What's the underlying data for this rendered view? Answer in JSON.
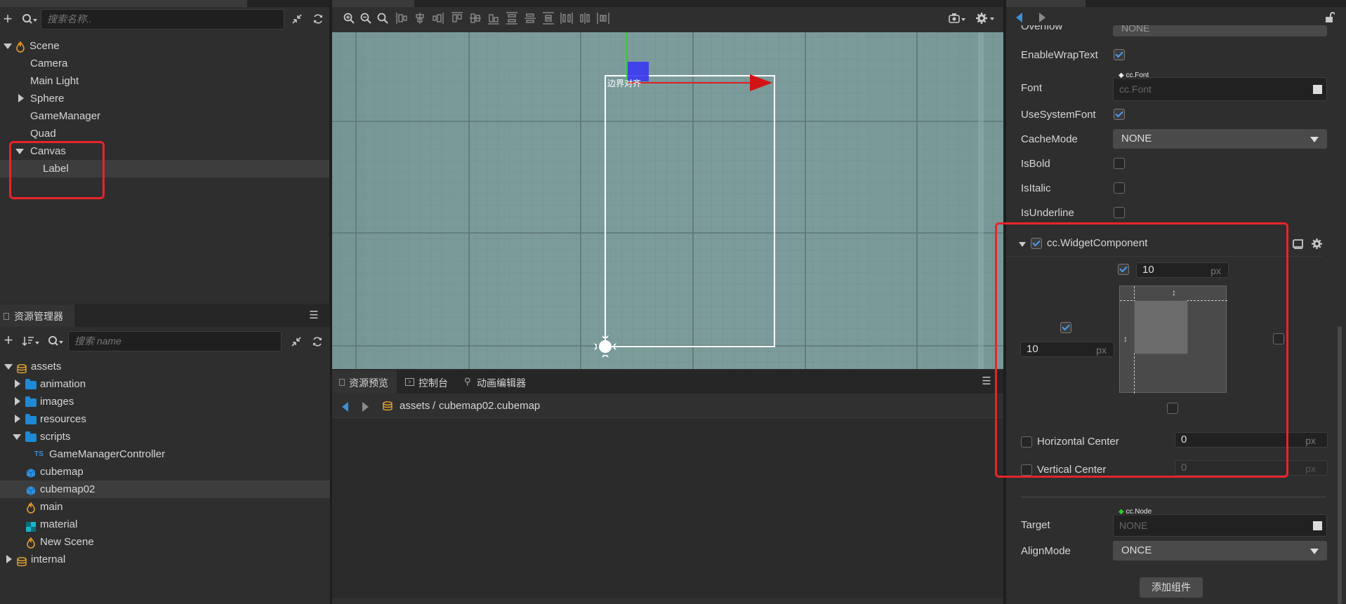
{
  "hierarchy": {
    "search_placeholder": "搜索名称..",
    "items": [
      {
        "label": "Scene",
        "indent": 0
      },
      {
        "label": "Camera"
      },
      {
        "label": "Main Light"
      },
      {
        "label": "Sphere"
      },
      {
        "label": "GameManager"
      },
      {
        "label": "Quad"
      },
      {
        "label": "Canvas"
      },
      {
        "label": "Label"
      }
    ]
  },
  "assets": {
    "title": "资源管理器",
    "search_placeholder": "搜索 name",
    "items": [
      {
        "label": "assets"
      },
      {
        "label": "animation"
      },
      {
        "label": "images"
      },
      {
        "label": "resources"
      },
      {
        "label": "scripts"
      },
      {
        "label": "GameManagerController",
        "badge": "TS"
      },
      {
        "label": "cubemap"
      },
      {
        "label": "cubemap02"
      },
      {
        "label": "main"
      },
      {
        "label": "material"
      },
      {
        "label": "New Scene"
      },
      {
        "label": "internal"
      }
    ]
  },
  "scene": {
    "label_overlay": "边界对齐"
  },
  "bottom_panel": {
    "tabs": [
      "资源预览",
      "控制台",
      "动画编辑器"
    ],
    "path_root": "assets",
    "path_sep": "/",
    "path_file": "cubemap02.cubemap"
  },
  "inspector": {
    "overflow_label": "Overflow",
    "overflow_value": "NONE",
    "props": {
      "enable_wrap": "EnableWrapText",
      "font": "Font",
      "font_type_badge": "cc.Font",
      "font_placeholder": "cc.Font",
      "use_system_font": "UseSystemFont",
      "cache_mode": "CacheMode",
      "cache_mode_value": "NONE",
      "is_bold": "IsBold",
      "is_italic": "IsItalic",
      "is_underline": "IsUnderline"
    },
    "widget": {
      "title": "cc.WidgetComponent",
      "top_value": "10",
      "left_value": "10",
      "unit": "px",
      "hcenter_label": "Horizontal Center",
      "hcenter_value": "0",
      "vcenter_label": "Vertical Center",
      "vcenter_value": "0"
    },
    "target_label": "Target",
    "target_badge": "cc.Node",
    "target_placeholder": "NONE",
    "align_mode_label": "AlignMode",
    "align_mode_value": "ONCE",
    "add_component": "添加组件"
  },
  "colors": {
    "accent": "#4a9ff5",
    "highlight": "#e8242b",
    "scene_bg": "#7b9a9a"
  }
}
